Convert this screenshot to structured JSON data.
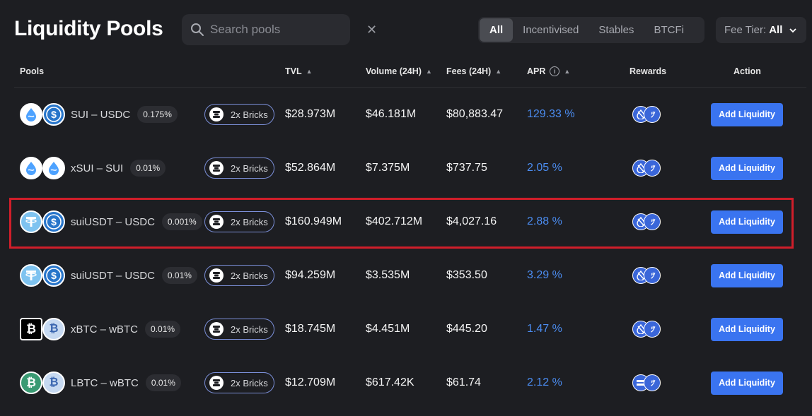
{
  "header": {
    "title": "Liquidity Pools",
    "search_placeholder": "Search pools",
    "tabs": [
      "All",
      "Incentivised",
      "Stables",
      "BTCFi"
    ],
    "active_tab": "All",
    "fee_tier_label": "Fee Tier:",
    "fee_tier_value": "All"
  },
  "columns": {
    "pools": "Pools",
    "tvl": "TVL",
    "volume": "Volume (24H)",
    "fees": "Fees (24H)",
    "apr": "APR",
    "rewards": "Rewards",
    "action": "Action"
  },
  "rows": [
    {
      "pair": "SUI – USDC",
      "fee": "0.175%",
      "bricks": "2x Bricks",
      "tvl": "$28.973M",
      "volume": "$46.181M",
      "fees": "$80,883.47",
      "apr": "129.33 %",
      "action": "Add Liquidity",
      "token_a": "sui-icon",
      "token_b": "usdc-icon",
      "reward_a": "sui-reward-icon"
    },
    {
      "pair": "xSUI – SUI",
      "fee": "0.01%",
      "bricks": "2x Bricks",
      "tvl": "$52.864M",
      "volume": "$7.375M",
      "fees": "$737.75",
      "apr": "2.05 %",
      "action": "Add Liquidity",
      "token_a": "xsui-icon",
      "token_b": "sui-icon",
      "reward_a": "sui-reward-icon"
    },
    {
      "pair": "suiUSDT – USDC",
      "fee": "0.001%",
      "bricks": "2x Bricks",
      "tvl": "$160.949M",
      "volume": "$402.712M",
      "fees": "$4,027.16",
      "apr": "2.88 %",
      "action": "Add Liquidity",
      "token_a": "usdt-icon",
      "token_b": "usdc-icon",
      "reward_a": "sui-reward-icon"
    },
    {
      "pair": "suiUSDT – USDC",
      "fee": "0.01%",
      "bricks": "2x Bricks",
      "tvl": "$94.259M",
      "volume": "$3.535M",
      "fees": "$353.50",
      "apr": "3.29 %",
      "action": "Add Liquidity",
      "token_a": "usdt-icon",
      "token_b": "usdc-icon",
      "reward_a": "sui-reward-icon"
    },
    {
      "pair": "xBTC – wBTC",
      "fee": "0.01%",
      "bricks": "2x Bricks",
      "tvl": "$18.745M",
      "volume": "$4.451M",
      "fees": "$445.20",
      "apr": "1.47 %",
      "action": "Add Liquidity",
      "token_a": "xbtc-icon",
      "token_b": "wbtc-icon",
      "reward_a": "sui-reward-icon"
    },
    {
      "pair": "LBTC – wBTC",
      "fee": "0.01%",
      "bricks": "2x Bricks",
      "tvl": "$12.709M",
      "volume": "$617.42K",
      "fees": "$61.74",
      "apr": "2.12 %",
      "action": "Add Liquidity",
      "token_a": "lbtc-icon",
      "token_b": "wbtc-icon",
      "reward_a": "equals-reward-icon"
    }
  ],
  "colors": {
    "background": "#1d1e22",
    "accent": "#3a74f0",
    "apr": "#4b8cf0",
    "highlight": "#d11e2a"
  }
}
